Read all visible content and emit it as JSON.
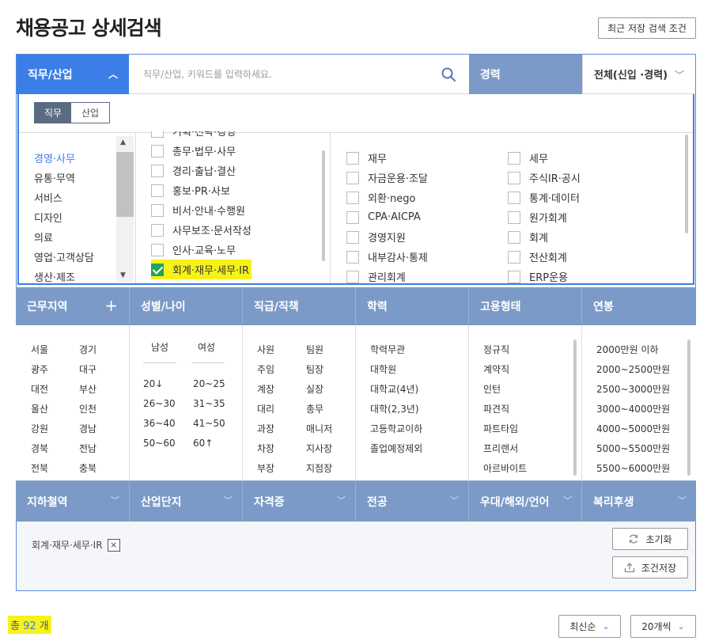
{
  "page": {
    "title": "채용공고 상세검색",
    "recent_saved_label": "최근 저장 검색 조건"
  },
  "search": {
    "job_tab_label": "직무/산업",
    "placeholder": "직무/산업, 키워드를 입력하세요.",
    "career_label": "경력",
    "career_value": "전체(신입 ·경력)"
  },
  "job_panel": {
    "toggle": [
      "직무",
      "산업"
    ],
    "categories": [
      "경영·사무",
      "유통·무역",
      "서비스",
      "디자인",
      "의료",
      "영업·고객상담",
      "생산·제조"
    ],
    "active_category": "경영·사무",
    "subcategories": [
      {
        "label": "기획·전략·경영",
        "checked": false
      },
      {
        "label": "총무·법무·사무",
        "checked": false
      },
      {
        "label": "경리·출납·결산",
        "checked": false
      },
      {
        "label": "홍보·PR·사보",
        "checked": false
      },
      {
        "label": "비서·안내·수행원",
        "checked": false
      },
      {
        "label": "사무보조·문서작성",
        "checked": false
      },
      {
        "label": "인사·교육·노무",
        "checked": false
      },
      {
        "label": "회계·재무·세무·IR",
        "checked": true
      }
    ],
    "details_left": [
      "재무",
      "자금운용·조달",
      "외환·nego",
      "CPA·AICPA",
      "경영지원",
      "내부감사·통제",
      "관리회계"
    ],
    "details_right": [
      "세무",
      "주식IR·공시",
      "통계·데이터",
      "원가회계",
      "회계",
      "전산회계",
      "ERP운용"
    ]
  },
  "filters": {
    "headers": [
      "근무지역",
      "성별/나이",
      "직급/직책",
      "학력",
      "고용형태",
      "연봉"
    ],
    "regions_left": [
      "서울",
      "광주",
      "대전",
      "울산",
      "강원",
      "경북",
      "전북"
    ],
    "regions_right": [
      "경기",
      "대구",
      "부산",
      "인천",
      "경남",
      "전남",
      "충북"
    ],
    "gender": [
      "남성",
      "여성"
    ],
    "ages_left": [
      "20↓",
      "26~30",
      "36~40",
      "50~60"
    ],
    "ages_right": [
      "20~25",
      "31~35",
      "41~50",
      "60↑"
    ],
    "positions_left": [
      "사원",
      "주임",
      "계장",
      "대리",
      "과장",
      "차장",
      "부장"
    ],
    "positions_right": [
      "팀원",
      "팀장",
      "실장",
      "총무",
      "매니저",
      "지사장",
      "지점장"
    ],
    "education": [
      "학력무관",
      "대학원",
      "대학교(4년)",
      "대학(2,3년)",
      "고등학교이하",
      "졸업예정제외"
    ],
    "employment": [
      "정규직",
      "계약직",
      "인턴",
      "파견직",
      "파트타임",
      "프리랜서",
      "아르바이트"
    ],
    "salary": [
      "2000만원 이하",
      "2000~2500만원",
      "2500~3000만원",
      "3000~4000만원",
      "4000~5000만원",
      "5000~5500만원",
      "5500~6000만원"
    ],
    "second_headers": [
      "지하철역",
      "산업단지",
      "자격증",
      "전공",
      "우대/해외/언어",
      "복리후생"
    ]
  },
  "selected": {
    "tag": "회계·재무·세무·IR",
    "remove_icon": "×",
    "reset_label": "초기화",
    "save_label": "조건저장"
  },
  "results": {
    "total_prefix": "총",
    "total_count": "92",
    "total_suffix": "개",
    "sort_label": "최신순",
    "per_page_label": "20개씩"
  },
  "colors": {
    "accent_blue": "#3b7ee8",
    "filter_bar": "#7b9ac7",
    "check_green": "#23a35d",
    "highlight": "#f7f21a"
  }
}
